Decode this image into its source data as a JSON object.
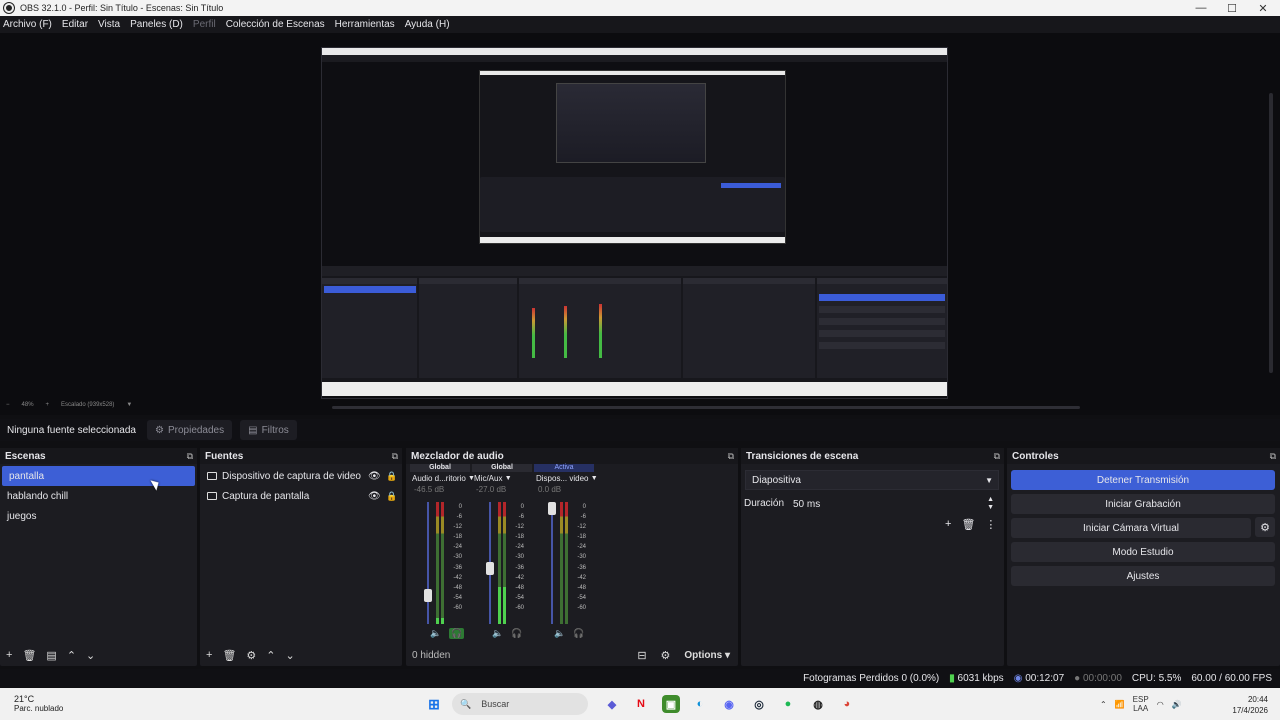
{
  "window": {
    "title": "OBS 32.1.0 - Perfil: Sin Título - Escenas: Sin Título",
    "controls": [
      "—",
      "☐",
      "✕"
    ]
  },
  "menu": [
    "Archivo (F)",
    "Editar",
    "Vista",
    "Paneles (D)",
    "Perfil",
    "Colección de Escenas",
    "Herramientas",
    "Ayuda (H)"
  ],
  "source_toolbar": {
    "status": "Ninguna fuente seleccionada",
    "properties": "Propiedades",
    "filters": "Filtros"
  },
  "scenes": {
    "title": "Escenas",
    "items": [
      "pantalla",
      "hablando chill",
      "juegos"
    ],
    "selected": 0
  },
  "sources": {
    "title": "Fuentes",
    "items": [
      "Dispositivo de captura de video",
      "Captura de pantalla"
    ]
  },
  "mixer": {
    "title": "Mezclador de audio",
    "channels": [
      {
        "tag": "Global",
        "name": "Audio d...ritorio",
        "db": "-46.5 dB",
        "level": 0.05,
        "fader": 0.2
      },
      {
        "tag": "Global",
        "name": "Mic/Aux",
        "db": "-27.0 dB",
        "level": 0.3,
        "fader": 0.45
      },
      {
        "tag": "Activa",
        "name": "Dispos... video",
        "db": "0.0 dB",
        "level": 0.0,
        "fader": 1.0
      }
    ],
    "scale": [
      "0",
      "-6",
      "-12",
      "-18",
      "-24",
      "-30",
      "-36",
      "-42",
      "-48",
      "-54",
      "-60"
    ],
    "hidden": "0 hidden",
    "options": "Options"
  },
  "transitions": {
    "title": "Transiciones de escena",
    "selected": "Diapositiva",
    "duration_label": "Duración",
    "duration_value": "50 ms"
  },
  "controls": {
    "title": "Controles",
    "stop_stream": "Detener Transmisión",
    "start_recording": "Iniciar Grabación",
    "virtual_camera": "Iniciar Cámara Virtual",
    "studio_mode": "Modo Estudio",
    "settings": "Ajustes"
  },
  "status": {
    "dropped": "Fotogramas Perdidos 0 (0.0%)",
    "bitrate": "6031 kbps",
    "stream_time": "00:12:07",
    "rec_time": "00:00:00",
    "cpu": "CPU: 5.5%",
    "fps": "60.00 / 60.00 FPS"
  },
  "preview_nested": {
    "zoom": "48%",
    "scale_text": "Escalado (939x528)"
  },
  "taskbar": {
    "temp": "21°C",
    "weather": "Parc. nublado",
    "search": "Buscar",
    "lang1": "ESP",
    "lang2": "LAA",
    "time": "20:44",
    "date": "17/4/2026"
  },
  "colors": {
    "accent": "#3d5fd6",
    "panel": "#1c1c21",
    "meter_green": "#4fd14f"
  }
}
